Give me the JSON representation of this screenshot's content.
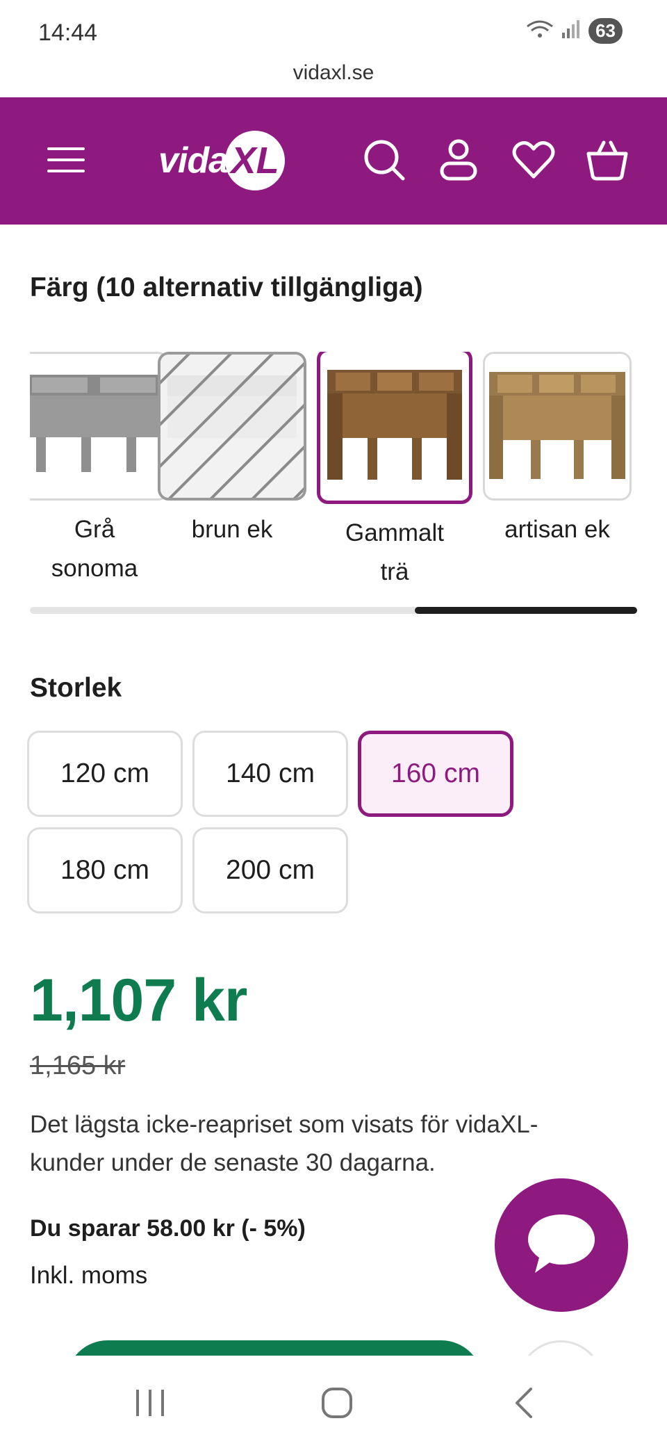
{
  "status": {
    "time": "14:44",
    "battery": "63"
  },
  "browser": {
    "url": "vidaxl.se"
  },
  "header": {
    "logo_text": "vida",
    "logo_badge": "XL",
    "brand_color": "#8e1a7f",
    "icons": [
      "menu-icon",
      "search-icon",
      "account-icon",
      "heart-icon",
      "basket-icon"
    ]
  },
  "color_section": {
    "title": "Färg (10 alternativ tillgängliga)",
    "options": [
      {
        "label_line1": "Grå",
        "label_line2": "sonoma",
        "state": "available"
      },
      {
        "label_line1": "brun ek",
        "label_line2": "",
        "state": "unavailable"
      },
      {
        "label_line1": "Gammalt",
        "label_line2": "trä",
        "state": "selected"
      },
      {
        "label_line1": "artisan ek",
        "label_line2": "",
        "state": "available"
      }
    ]
  },
  "size_section": {
    "title": "Storlek",
    "sizes": [
      {
        "label": "120 cm",
        "selected": false
      },
      {
        "label": "140 cm",
        "selected": false
      },
      {
        "label": "160 cm",
        "selected": true
      },
      {
        "label": "180 cm",
        "selected": false
      },
      {
        "label": "200 cm",
        "selected": false
      }
    ]
  },
  "pricing": {
    "price": "1,107 kr",
    "old_price": "1,165 kr",
    "note": "Det lägsta icke-reapriset som visats för vidaXL-kunder under de senaste 30 dagarna.",
    "savings": "Du sparar 58.00 kr (- 5%)",
    "vat": "Inkl. moms",
    "price_color": "#0e7c4f"
  }
}
